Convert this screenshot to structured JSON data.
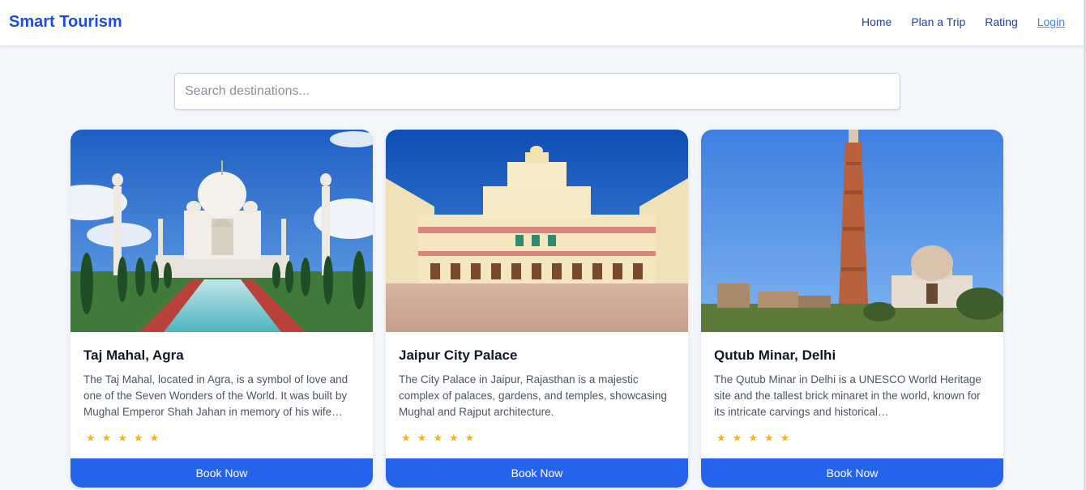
{
  "nav": {
    "brand": "Smart Tourism",
    "links": [
      "Home",
      "Plan a Trip",
      "Rating",
      "Login"
    ]
  },
  "search": {
    "placeholder": "Search destinations..."
  },
  "cards": [
    {
      "title": "Taj Mahal, Agra",
      "description": "The Taj Mahal, located in Agra, is a symbol of love and one of the Seven Wonders of the World. It was built by Mughal Emperor Shah Jahan in memory of his wife…",
      "rating": 5,
      "button": "Book Now",
      "image": "taj-mahal-photo"
    },
    {
      "title": "Jaipur City Palace",
      "description": "The City Palace in Jaipur, Rajasthan is a majestic complex of palaces, gardens, and temples, showcasing Mughal and Rajput architecture.",
      "rating": 5,
      "button": "Book Now",
      "image": "city-palace-photo"
    },
    {
      "title": "Qutub Minar, Delhi",
      "description": "The Qutub Minar in Delhi is a UNESCO World Heritage site and the tallest brick minaret in the world, known for its intricate carvings and historical…",
      "rating": 5,
      "button": "Book Now",
      "image": "qutub-minar-photo"
    }
  ],
  "colors": {
    "brand": "#1d4ed8",
    "button": "#2563eb",
    "star": "#f5b80a"
  }
}
